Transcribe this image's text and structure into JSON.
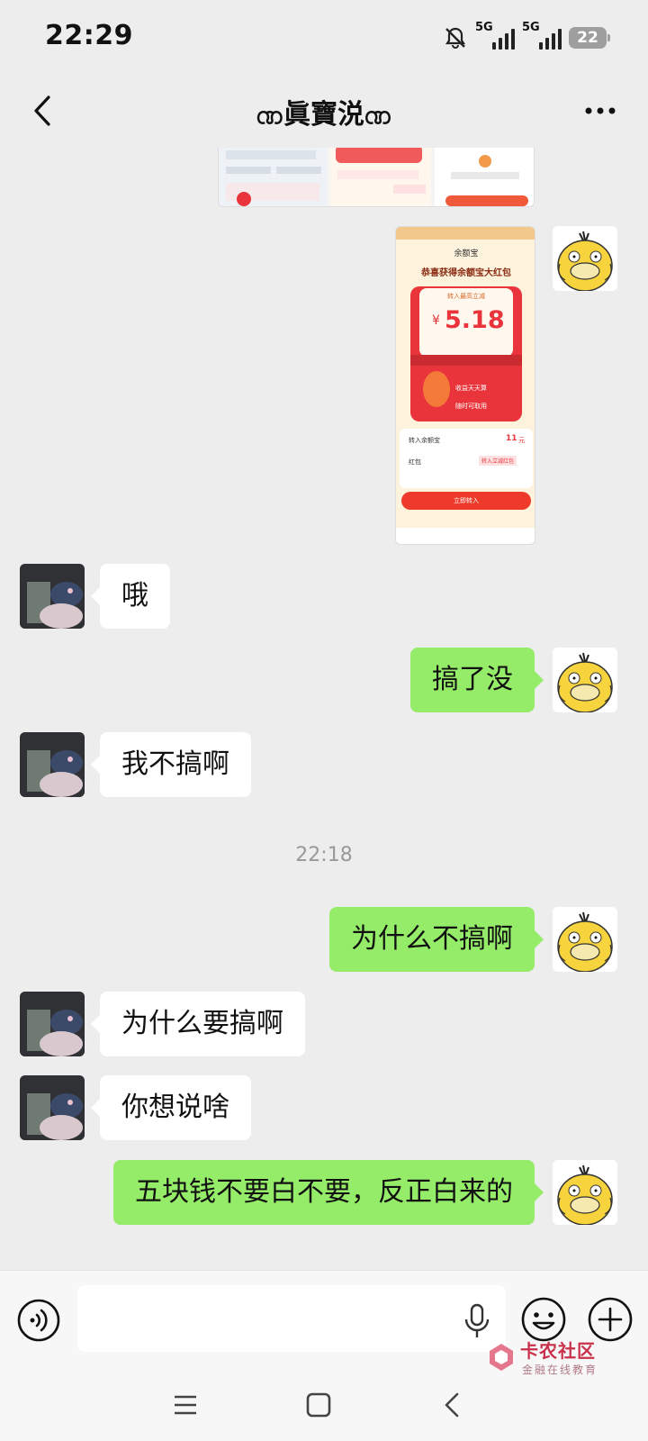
{
  "status_bar": {
    "time": "22:29",
    "network1": "5G",
    "network2": "5G",
    "battery": "22",
    "icons": [
      "mute-bell-icon",
      "signal-icon",
      "signal-icon",
      "battery-icon"
    ]
  },
  "header": {
    "title": "ဏ眞寶涚ဏ",
    "back_icon": "chevron-left-icon",
    "more_icon": "more-dots-icon"
  },
  "image_message": {
    "brand": "余额宝",
    "headline": "恭喜获得余额宝大红包",
    "tag": "转入最高立减",
    "amount_symbol": "¥",
    "amount": "5.18",
    "benefit1": "收益天天算",
    "benefit2": "随时可取用",
    "row1_label": "转入余额宝",
    "row1_value": "11",
    "row1_unit": "元",
    "row2_label": "红包",
    "row2_value": "转入立减红包",
    "cta": "立即转入"
  },
  "messages": [
    {
      "side": "in",
      "text": "哦"
    },
    {
      "side": "out",
      "text": "搞了没"
    },
    {
      "side": "in",
      "text": "我不搞啊"
    },
    {
      "side": "time",
      "text": "22:18"
    },
    {
      "side": "out",
      "text": "为什么不搞啊"
    },
    {
      "side": "in",
      "text": "为什么要搞啊"
    },
    {
      "side": "in",
      "text": "你想说啥"
    },
    {
      "side": "out",
      "text": "五块钱不要白不要，反正白来的"
    }
  ],
  "input_bar": {
    "placeholder": "",
    "icons": [
      "voice-icon",
      "mic-icon",
      "emoji-icon",
      "plus-icon"
    ]
  },
  "watermark": {
    "title": "卡农社区",
    "subtitle": "金融在线教育"
  },
  "colors": {
    "background": "#ededed",
    "outgoing_bubble": "#95ec69",
    "incoming_bubble": "#ffffff",
    "red_packet": "#e8343a"
  }
}
